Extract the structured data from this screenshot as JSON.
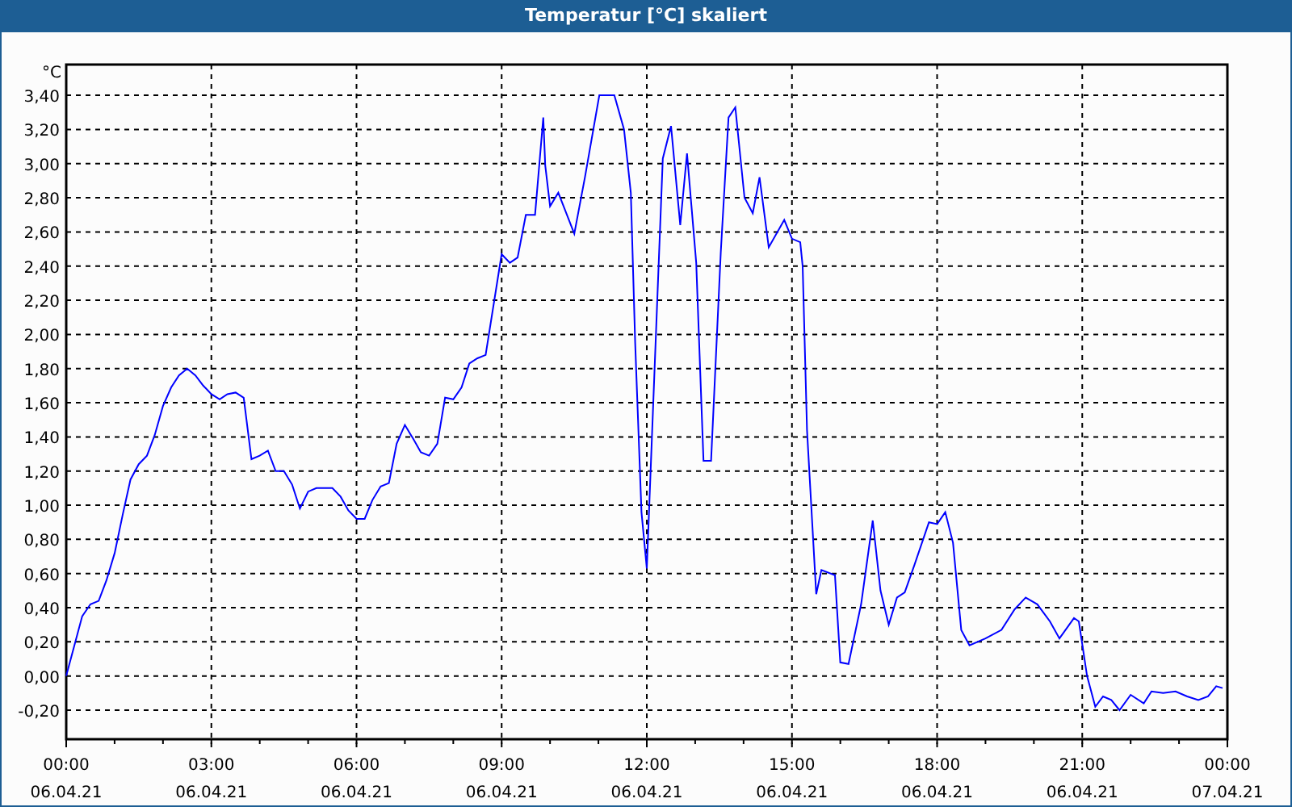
{
  "window": {
    "title": "Temperatur [°C] skaliert"
  },
  "chart": {
    "chart_data": {
      "type": "line",
      "grid": true,
      "ylabel": "°C",
      "xlim": [
        0,
        24
      ],
      "ylim": [
        -0.37,
        3.58
      ],
      "xticks": [
        {
          "value": 0,
          "label": "00:00"
        },
        {
          "value": 3,
          "label": "03:00"
        },
        {
          "value": 6,
          "label": "06:00"
        },
        {
          "value": 9,
          "label": "09:00"
        },
        {
          "value": 12,
          "label": "12:00"
        },
        {
          "value": 15,
          "label": "15:00"
        },
        {
          "value": 18,
          "label": "18:00"
        },
        {
          "value": 21,
          "label": "21:00"
        },
        {
          "value": 24,
          "label": "00:00"
        }
      ],
      "yticks": [
        {
          "value": -0.2,
          "label": "-0,20"
        },
        {
          "value": 0,
          "label": "0,00"
        },
        {
          "value": 0.2,
          "label": "0,20"
        },
        {
          "value": 0.4,
          "label": "0,40"
        },
        {
          "value": 0.6,
          "label": "0,60"
        },
        {
          "value": 0.8,
          "label": "0,80"
        },
        {
          "value": 1,
          "label": "1,00"
        },
        {
          "value": 1.2,
          "label": "1,20"
        },
        {
          "value": 1.4,
          "label": "1,40"
        },
        {
          "value": 1.6,
          "label": "1,60"
        },
        {
          "value": 1.8,
          "label": "1,80"
        },
        {
          "value": 2,
          "label": "2,00"
        },
        {
          "value": 2.2,
          "label": "2,20"
        },
        {
          "value": 2.4,
          "label": "2,40"
        },
        {
          "value": 2.6,
          "label": "2,60"
        },
        {
          "value": 2.8,
          "label": "2,80"
        },
        {
          "value": 3,
          "label": "3,00"
        },
        {
          "value": 3.2,
          "label": "3,20"
        },
        {
          "value": 3.4,
          "label": "3,40"
        }
      ],
      "x": [
        0,
        0.17,
        0.33,
        0.5,
        0.67,
        0.83,
        1,
        1.17,
        1.33,
        1.5,
        1.67,
        1.83,
        2,
        2.17,
        2.33,
        2.5,
        2.67,
        2.83,
        3,
        3.17,
        3.33,
        3.5,
        3.67,
        3.83,
        4,
        4.17,
        4.33,
        4.5,
        4.67,
        4.83,
        5,
        5.17,
        5.5,
        5.67,
        5.83,
        6,
        6.17,
        6.33,
        6.5,
        6.67,
        6.83,
        7,
        7.17,
        7.33,
        7.5,
        7.67,
        7.83,
        8,
        8.17,
        8.33,
        8.5,
        8.67,
        9,
        9.17,
        9.33,
        9.5,
        9.69,
        9.86,
        9.9,
        10,
        10.17,
        10.5,
        10.72,
        11.02,
        11.33,
        11.53,
        11.67,
        11.76,
        11.89,
        12,
        12.33,
        12.5,
        12.69,
        12.83,
        13.02,
        13.17,
        13.33,
        13.53,
        13.69,
        13.83,
        14.02,
        14.19,
        14.33,
        14.52,
        14.84,
        15,
        15.17,
        15.22,
        15.31,
        15.5,
        15.61,
        15.89,
        16,
        16.17,
        16.43,
        16.67,
        16.83,
        17,
        17.17,
        17.33,
        17.53,
        17.83,
        18,
        18.17,
        18.33,
        18.5,
        18.67,
        19,
        19.33,
        19.6,
        19.83,
        20.07,
        20.33,
        20.53,
        20.83,
        20.93,
        21.1,
        21.27,
        21.43,
        21.6,
        21.77,
        22,
        22.27,
        22.43,
        22.67,
        22.93,
        23.17,
        23.4,
        23.6,
        23.77,
        23.9
      ],
      "series": [
        {
          "color": "#0000ff",
          "values": [
            0,
            0.18,
            0.35,
            0.42,
            0.44,
            0.56,
            0.72,
            0.95,
            1.15,
            1.24,
            1.29,
            1.41,
            1.58,
            1.69,
            1.76,
            1.8,
            1.76,
            1.7,
            1.65,
            1.62,
            1.65,
            1.66,
            1.63,
            1.27,
            1.29,
            1.32,
            1.2,
            1.2,
            1.12,
            0.98,
            1.08,
            1.1,
            1.1,
            1.05,
            0.97,
            0.92,
            0.92,
            1.03,
            1.11,
            1.13,
            1.36,
            1.47,
            1.39,
            1.31,
            1.29,
            1.36,
            1.63,
            1.62,
            1.69,
            1.83,
            1.86,
            1.88,
            2.47,
            2.42,
            2.45,
            2.7,
            2.7,
            3.27,
            2.99,
            2.75,
            2.83,
            2.59,
            2.92,
            3.4,
            3.4,
            3.2,
            2.83,
            1.95,
            0.96,
            0.63,
            3.03,
            3.22,
            2.64,
            3.06,
            2.42,
            1.26,
            1.26,
            2.48,
            3.27,
            3.33,
            2.8,
            2.71,
            2.92,
            2.51,
            2.67,
            2.56,
            2.54,
            2.4,
            1.44,
            0.48,
            0.62,
            0.59,
            0.08,
            0.07,
            0.42,
            0.91,
            0.5,
            0.3,
            0.46,
            0.49,
            0.65,
            0.9,
            0.89,
            0.96,
            0.78,
            0.27,
            0.18,
            0.22,
            0.27,
            0.39,
            0.46,
            0.42,
            0.32,
            0.22,
            0.34,
            0.32,
            0,
            -0.18,
            -0.12,
            -0.14,
            -0.2,
            -0.11,
            -0.16,
            -0.09,
            -0.1,
            -0.09,
            -0.12,
            -0.14,
            -0.12,
            -0.06,
            -0.07
          ]
        }
      ]
    },
    "x_axis_dates": [
      "06.04.21",
      "06.04.21",
      "06.04.21",
      "06.04.21",
      "06.04.21",
      "06.04.21",
      "06.04.21",
      "06.04.21",
      "07.04.21"
    ]
  }
}
